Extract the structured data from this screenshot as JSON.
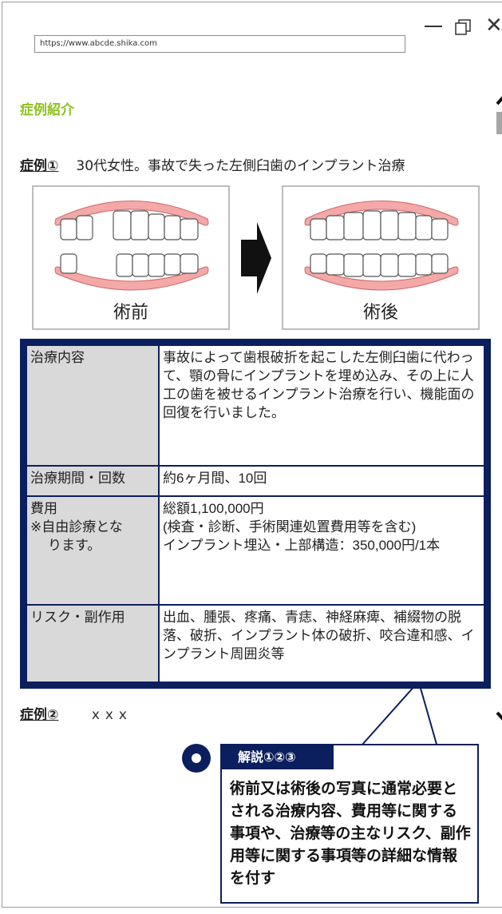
{
  "window": {
    "minimize_glyph": "—",
    "close_glyph": "✕"
  },
  "browser": {
    "url": "https;//www.abcde.shika.com"
  },
  "section": {
    "title": "症例紹介",
    "title_color": "#8dc21f"
  },
  "case1": {
    "label": "症例①",
    "description": "30代女性。事故で失った左側臼歯のインプラント治療",
    "before_caption": "術前",
    "after_caption": "術後"
  },
  "info_table": {
    "rows": [
      {
        "key": "治療内容",
        "value": "事故によって歯根破折を起こした左側臼歯に代わって、顎の骨にインプラントを埋め込み、その上に人工の歯を被せるインプラント治療を行い、機能面の回復を行いました。"
      },
      {
        "key": "治療期間・回数",
        "value": "約6ヶ月間、10回"
      },
      {
        "key": "費用\n※自由診療となります。",
        "key_line1": "費用",
        "key_line2": "※自由診療とな",
        "key_line3": "ります。",
        "value_line1": "総額1,100,000円",
        "value_line2": "(検査・診断、手術関連処置費用等を含む)",
        "value_line3": "インプラント埋込・上部構造：350,000円/1本"
      },
      {
        "key": "リスク・副作用",
        "value": "出血、腫張、疼痛、青痣、神経麻痺、補綴物の脱落、破折、インプラント体の破折、咬合違和感、インプラント周囲炎等"
      }
    ]
  },
  "case2": {
    "label": "症例②",
    "description": "ｘｘｘ"
  },
  "explain": {
    "title": "解説①②③",
    "body": "術前又は術後の写真に通常必要とされる治療内容、費用等に関する事項や、治療等の主なリスク、副作用等に関する事項等の詳細な情報を付す",
    "accent_color": "#0b1f5e"
  }
}
